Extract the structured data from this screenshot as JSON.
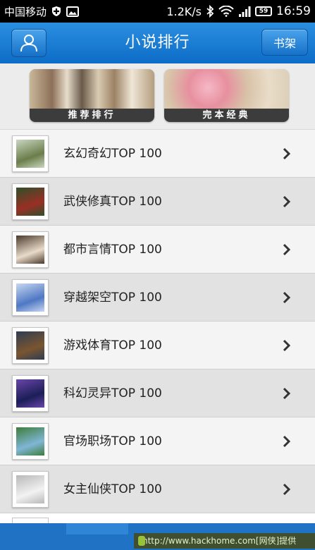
{
  "status_bar": {
    "carrier": "中国移动",
    "speed": "1.2K/s",
    "battery": "59",
    "time": "16:59"
  },
  "header": {
    "title": "小说排行",
    "bookshelf_label": "书架"
  },
  "banners": [
    {
      "label": "推荐排行"
    },
    {
      "label": "完本经典"
    }
  ],
  "categories": [
    {
      "label": "玄幻奇幻TOP  100",
      "thumb_colors": [
        "#6b7d4a",
        "#c9d7c0"
      ]
    },
    {
      "label": "武侠修真TOP  100",
      "thumb_colors": [
        "#9a2f24",
        "#2e4f2a"
      ]
    },
    {
      "label": "都市言情TOP  100",
      "thumb_colors": [
        "#e9dbc9",
        "#4a3a2c"
      ]
    },
    {
      "label": "穿越架空TOP  100",
      "thumb_colors": [
        "#4f78c4",
        "#c7d7f0"
      ]
    },
    {
      "label": "游戏体育TOP  100",
      "thumb_colors": [
        "#7a5530",
        "#2e3c52"
      ]
    },
    {
      "label": "科幻灵异TOP  100",
      "thumb_colors": [
        "#1b1e58",
        "#6a46a8"
      ]
    },
    {
      "label": "官场职场TOP  100",
      "thumb_colors": [
        "#7fb6d6",
        "#3e7d3a"
      ]
    },
    {
      "label": "女主仙侠TOP  100",
      "thumb_colors": [
        "#f2f2f2",
        "#b8b8b8"
      ]
    }
  ],
  "watermark": "http://www.hackhome.com[网侠]提供",
  "colors": {
    "header_blue": "#1a7fd6",
    "row_light": "#f4f4f4",
    "row_dark": "#e2e2e2"
  }
}
